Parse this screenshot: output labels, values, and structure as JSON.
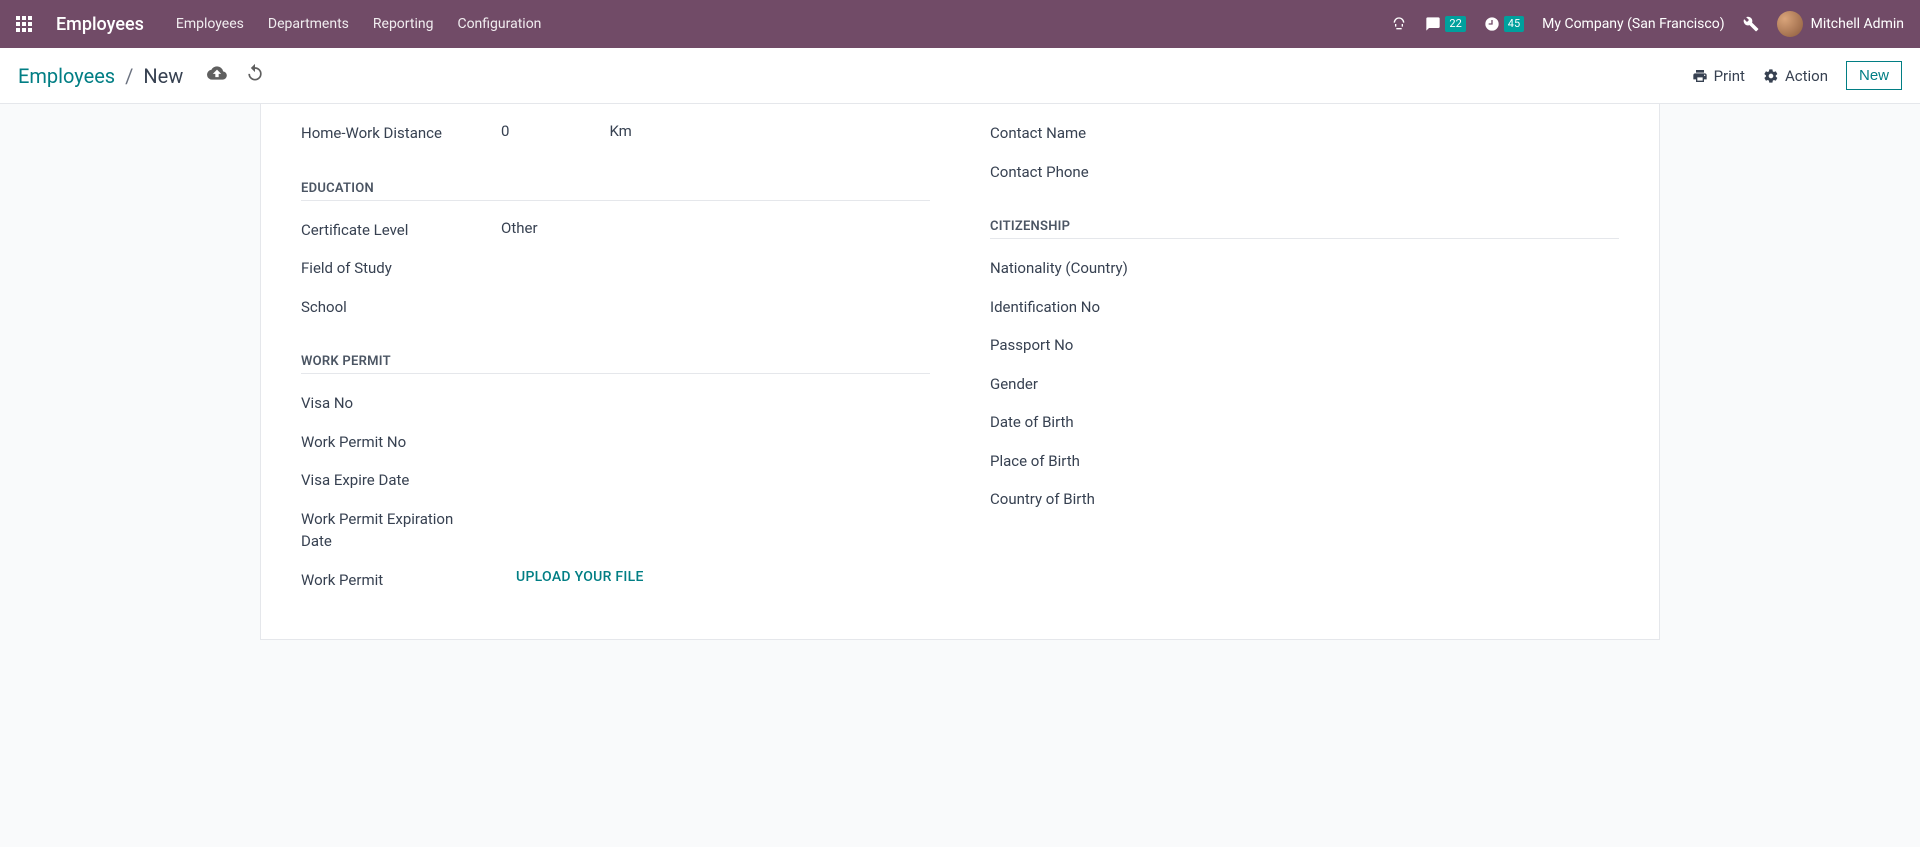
{
  "navbar": {
    "appName": "Employees",
    "menu": [
      "Employees",
      "Departments",
      "Reporting",
      "Configuration"
    ],
    "messagesBadge": "22",
    "activitiesBadge": "45",
    "companyName": "My Company (San Francisco)",
    "userName": "Mitchell Admin"
  },
  "controlBar": {
    "breadcrumbRoot": "Employees",
    "breadcrumbCurrent": "New",
    "printLabel": "Print",
    "actionLabel": "Action",
    "newLabel": "New"
  },
  "form": {
    "left": {
      "homeWorkDistanceLabel": "Home-Work Distance",
      "homeWorkDistanceValue": "0",
      "homeWorkDistanceUnit": "Km",
      "educationTitle": "Education",
      "certificateLevelLabel": "Certificate Level",
      "certificateLevelValue": "Other",
      "fieldOfStudyLabel": "Field of Study",
      "schoolLabel": "School",
      "workPermitTitle": "Work Permit",
      "visaNoLabel": "Visa No",
      "workPermitNoLabel": "Work Permit No",
      "visaExpireDateLabel": "Visa Expire Date",
      "workPermitExpDateLabel": "Work Permit Expiration Date",
      "workPermitLabel": "Work Permit",
      "uploadFileLabel": "Upload your file"
    },
    "right": {
      "contactNameLabel": "Contact Name",
      "contactPhoneLabel": "Contact Phone",
      "citizenshipTitle": "Citizenship",
      "nationalityLabel": "Nationality (Country)",
      "identificationNoLabel": "Identification No",
      "passportNoLabel": "Passport No",
      "genderLabel": "Gender",
      "dateOfBirthLabel": "Date of Birth",
      "placeOfBirthLabel": "Place of Birth",
      "countryOfBirthLabel": "Country of Birth"
    }
  }
}
